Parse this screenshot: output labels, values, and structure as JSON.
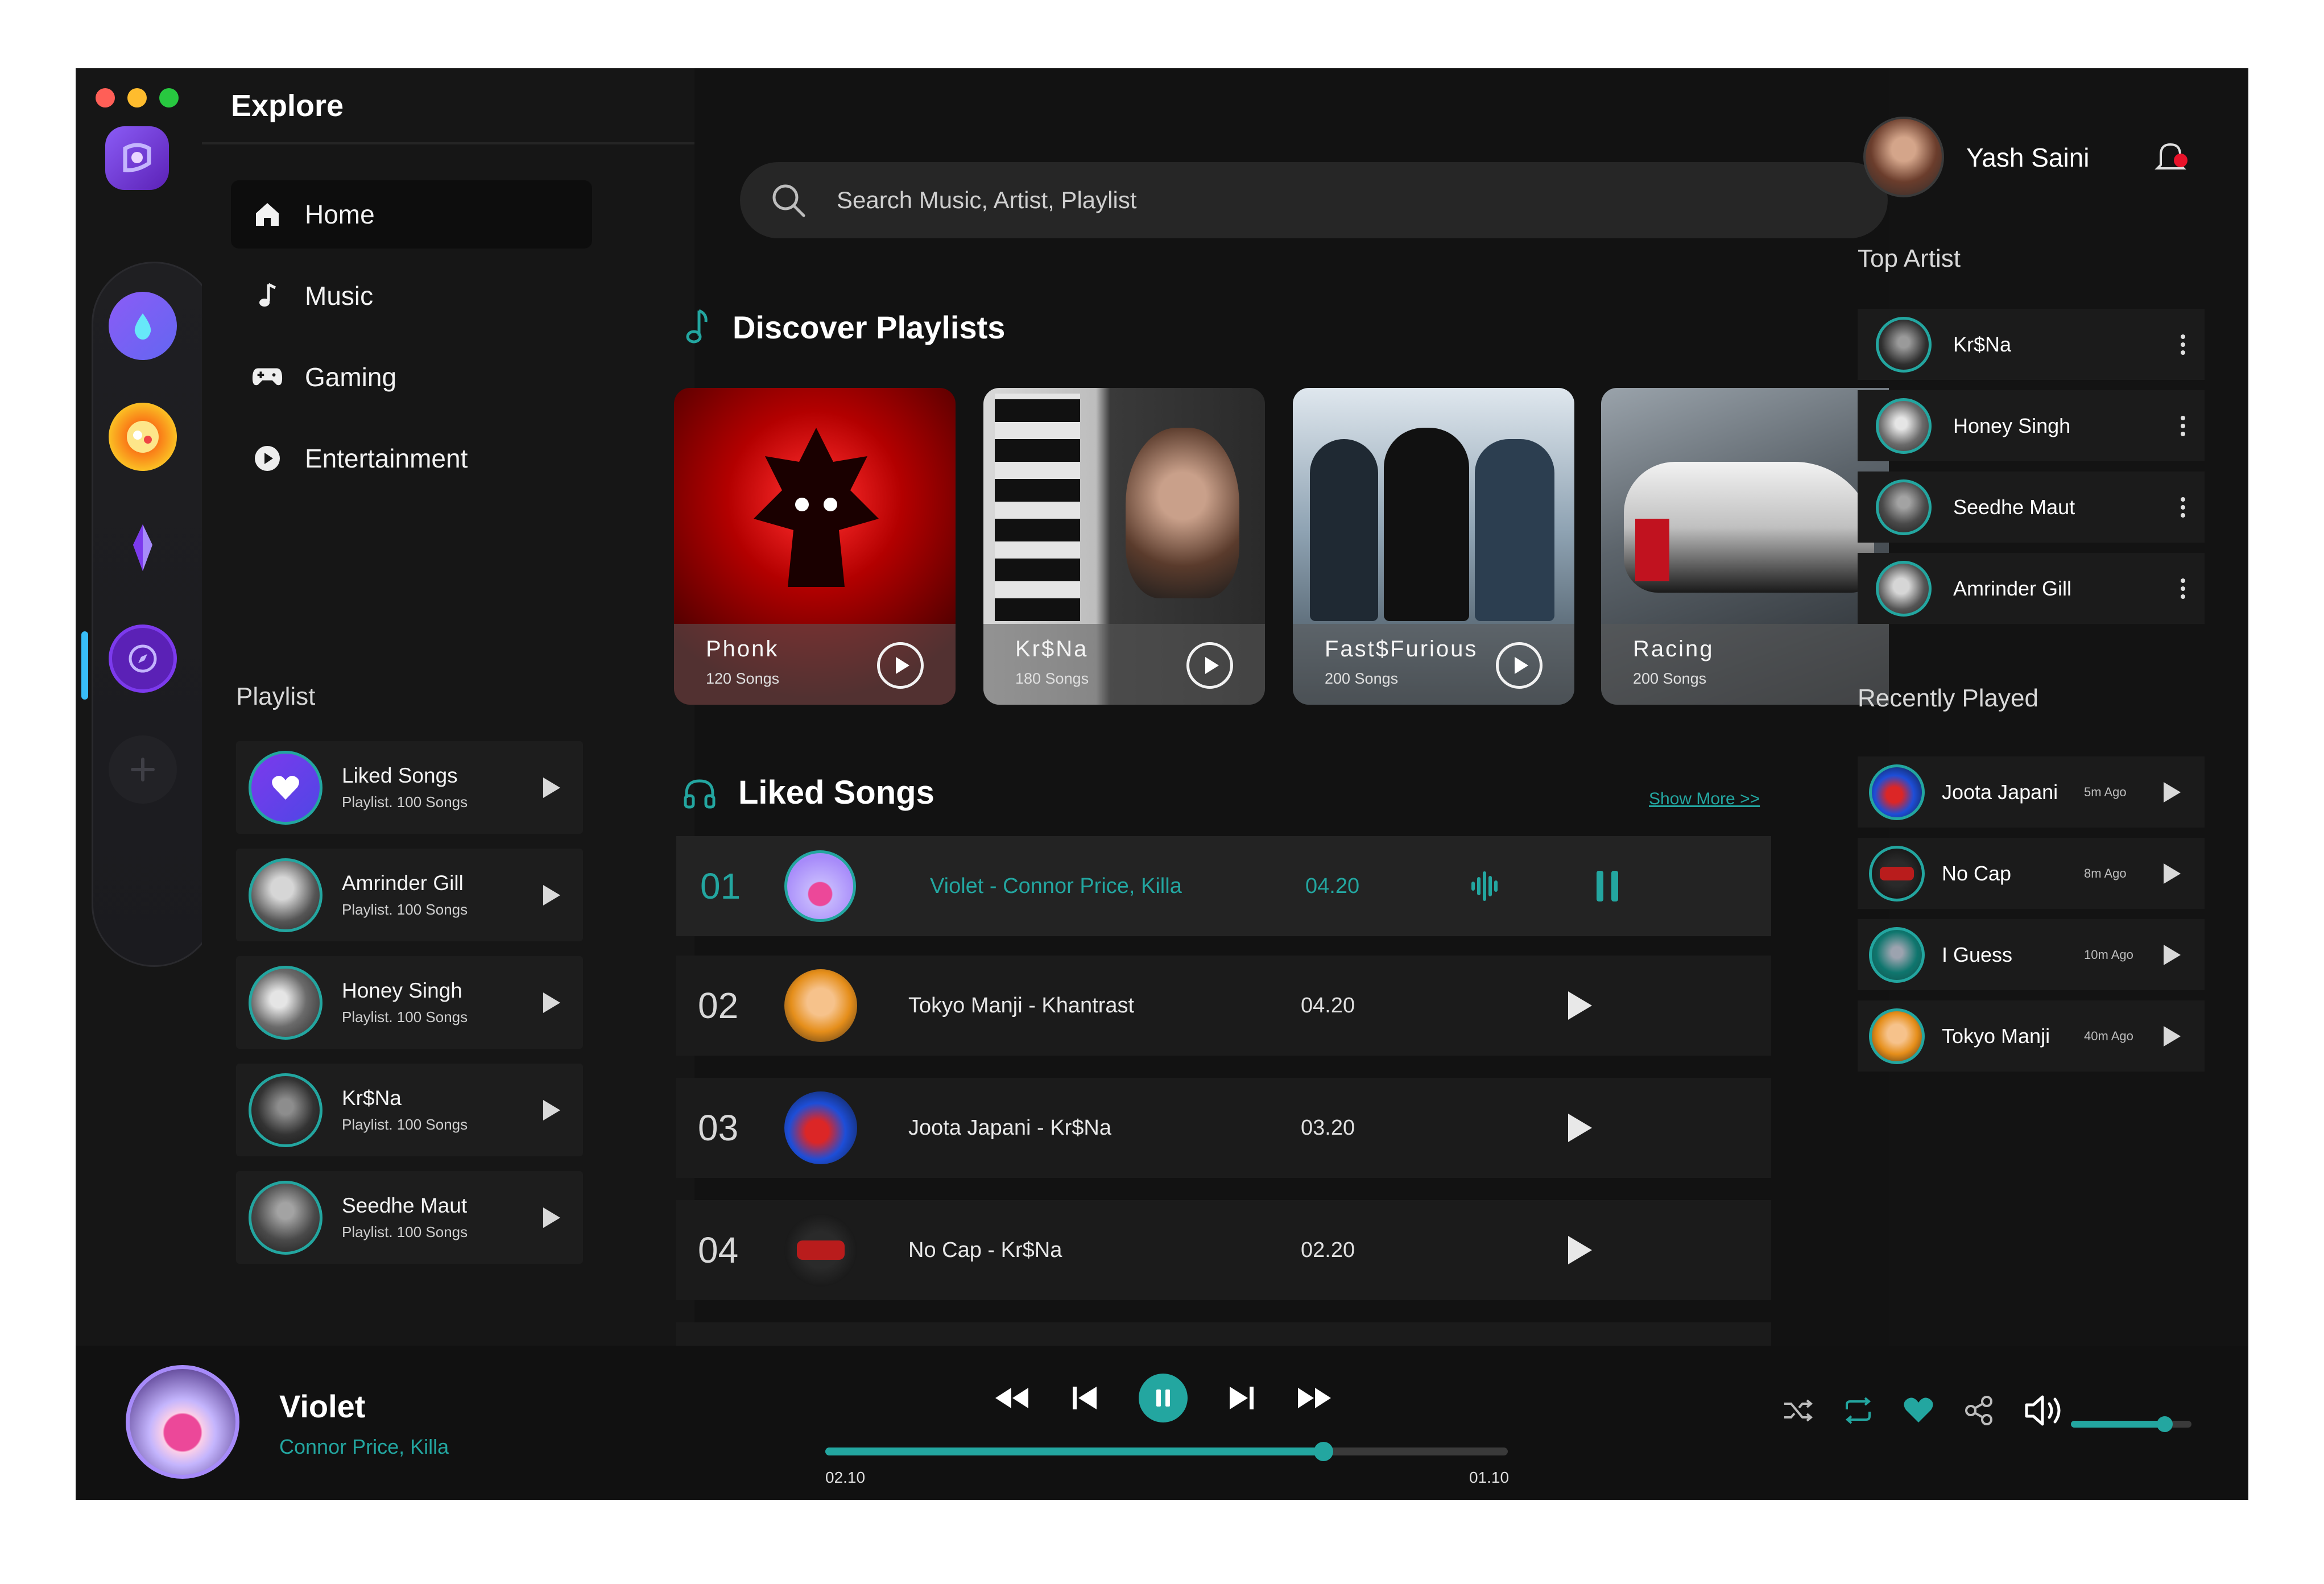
{
  "window": {
    "traffic_colors": [
      "#ff5f57",
      "#febc2e",
      "#28c840"
    ]
  },
  "colors": {
    "accent": "#23a6a0",
    "background": "#141414",
    "notification": "#e8132a"
  },
  "sidebar": {
    "title": "Explore",
    "nav": [
      {
        "label": "Home",
        "icon": "home-icon",
        "active": true
      },
      {
        "label": "Music",
        "icon": "music-note-icon"
      },
      {
        "label": "Gaming",
        "icon": "gamepad-icon"
      },
      {
        "label": "Entertainment",
        "icon": "play-circle-icon"
      }
    ],
    "playlist_heading": "Playlist",
    "playlists": [
      {
        "name": "Liked Songs",
        "sub": "Playlist. 100 Songs"
      },
      {
        "name": "Amrinder Gill",
        "sub": "Playlist. 100 Songs"
      },
      {
        "name": "Honey Singh",
        "sub": "Playlist. 100 Songs"
      },
      {
        "name": "Kr$Na",
        "sub": "Playlist. 100 Songs"
      },
      {
        "name": "Seedhe Maut",
        "sub": "Playlist. 100 Songs"
      }
    ]
  },
  "search": {
    "placeholder": "Search Music, Artist, Playlist"
  },
  "discover": {
    "heading": "Discover Playlists",
    "cards": [
      {
        "title": "Phonk",
        "sub": "120 Songs"
      },
      {
        "title": "Kr$Na",
        "sub": "180 Songs"
      },
      {
        "title": "Fast$Furious",
        "sub": "200 Songs"
      },
      {
        "title": "Racing",
        "sub": "200 Songs"
      }
    ]
  },
  "liked": {
    "heading": "Liked Songs",
    "show_more": "Show More >>",
    "songs": [
      {
        "num": "01",
        "title": "Violet - Connor Price, Killa",
        "duration": "04.20",
        "playing": true
      },
      {
        "num": "02",
        "title": "Tokyo Manji - Khantrast",
        "duration": "04.20"
      },
      {
        "num": "03",
        "title": "Joota Japani - Kr$Na",
        "duration": "03.20"
      },
      {
        "num": "04",
        "title": "No Cap - Kr$Na",
        "duration": "02.20"
      }
    ]
  },
  "user": {
    "name": "Yash Saini"
  },
  "top_artist": {
    "heading": "Top Artist",
    "artists": [
      "Kr$Na",
      "Honey Singh",
      "Seedhe Maut",
      "Amrinder Gill"
    ]
  },
  "recent": {
    "heading": "Recently Played",
    "items": [
      {
        "title": "Joota Japani",
        "ago": "5m Ago"
      },
      {
        "title": "No Cap",
        "ago": "8m Ago"
      },
      {
        "title": "I Guess",
        "ago": "10m Ago"
      },
      {
        "title": "Tokyo Manji",
        "ago": "40m Ago"
      }
    ]
  },
  "player": {
    "title": "Violet",
    "artist": "Connor Price, Killa",
    "elapsed": "02.10",
    "remaining": "01.10",
    "progress": 0.73,
    "volume": 0.78,
    "liked": true
  }
}
